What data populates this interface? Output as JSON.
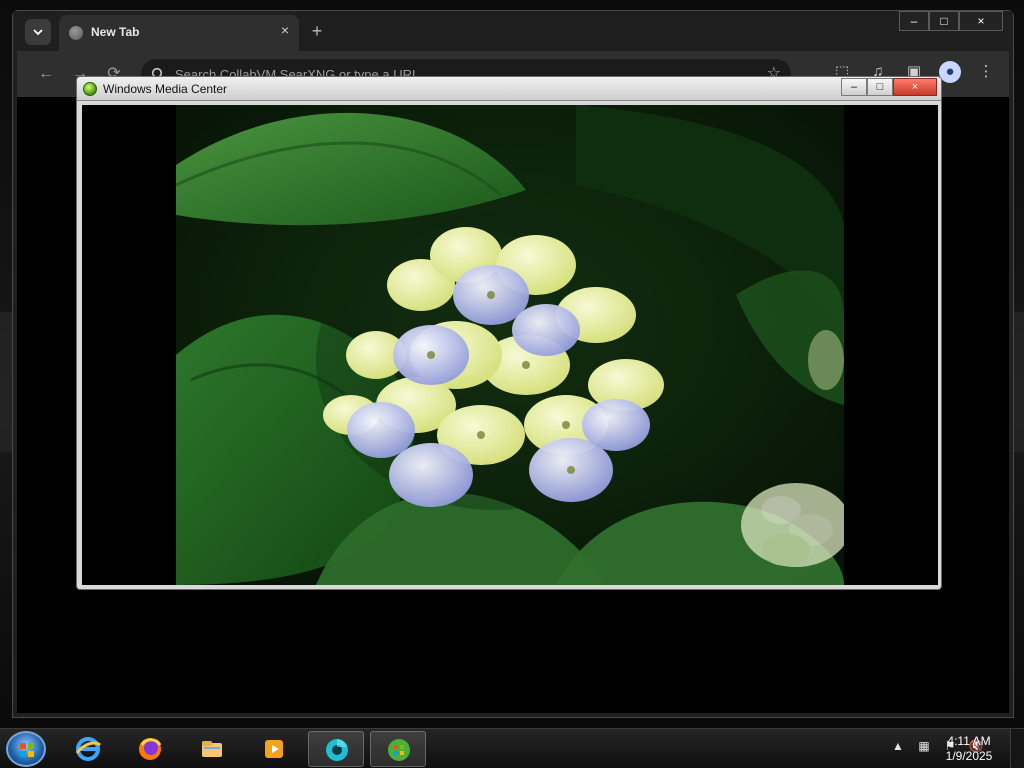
{
  "browser": {
    "tab_title": "New Tab",
    "tab_close": "×",
    "new_tab": "+",
    "window_controls": {
      "minimize": "–",
      "maximize": "□",
      "close": "×"
    },
    "omnibox_placeholder": "Search CollabVM SearXNG or type a URL",
    "nav": {
      "back": "←",
      "forward": "→",
      "reload": "⟳"
    },
    "toolbar_icons": [
      "extensions-icon",
      "media-icon",
      "side-panel-icon",
      "profile-icon",
      "menu-icon"
    ]
  },
  "wmc": {
    "title": "Windows Media Center",
    "controls": {
      "minimize": "–",
      "maximize": "□",
      "close": "×"
    }
  },
  "taskbar": {
    "apps": [
      {
        "name": "internet-explorer-icon"
      },
      {
        "name": "firefox-icon"
      },
      {
        "name": "file-explorer-icon"
      },
      {
        "name": "media-player-icon"
      },
      {
        "name": "chrome-taskbar-icon"
      },
      {
        "name": "windows-media-center-taskbar-icon"
      }
    ],
    "tray_icons": [
      "show-hidden-icons",
      "network-icon",
      "action-center-icon",
      "volume-muted-icon"
    ],
    "time": "4:11 AM",
    "date": "1/9/2025"
  }
}
